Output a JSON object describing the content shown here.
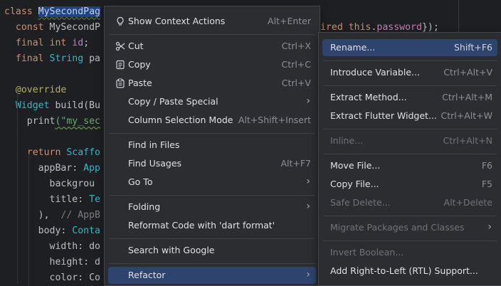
{
  "editor": {
    "lines": [
      {
        "segments": [
          {
            "t": "class ",
            "c": "kw"
          },
          {
            "t": "MySecondPag",
            "c": "sel"
          }
        ]
      },
      {
        "segments": [
          {
            "t": "  "
          },
          {
            "t": "const ",
            "c": "kw"
          },
          {
            "t": "MySecondP",
            "c": ""
          }
        ]
      },
      {
        "segments": [
          {
            "t": "  "
          },
          {
            "t": "final ",
            "c": "kw"
          },
          {
            "t": "int ",
            "c": "kw"
          },
          {
            "t": "id",
            "c": "ty"
          },
          {
            "t": ";"
          }
        ]
      },
      {
        "segments": [
          {
            "t": "  "
          },
          {
            "t": "final ",
            "c": "kw"
          },
          {
            "t": "String ",
            "c": "cl"
          },
          {
            "t": "pa",
            "c": ""
          }
        ]
      },
      {
        "segments": [
          {
            "t": ""
          }
        ]
      },
      {
        "segments": [
          {
            "t": "  "
          },
          {
            "t": "@override",
            "c": "an"
          }
        ]
      },
      {
        "segments": [
          {
            "t": "  "
          },
          {
            "t": "Widget ",
            "c": "cl"
          },
          {
            "t": "build",
            "c": ""
          },
          {
            "t": "(Bu"
          }
        ]
      },
      {
        "segments": [
          {
            "t": "    "
          },
          {
            "t": "print",
            "c": ""
          },
          {
            "t": "(\"my_sec",
            "c": "st wv"
          }
        ]
      },
      {
        "segments": [
          {
            "t": ""
          }
        ]
      },
      {
        "segments": [
          {
            "t": "    "
          },
          {
            "t": "return ",
            "c": "kw"
          },
          {
            "t": "Scaffo",
            "c": "cl"
          }
        ]
      },
      {
        "segments": [
          {
            "t": "      "
          },
          {
            "t": "appBar",
            "c": ""
          },
          {
            "t": ": "
          },
          {
            "t": "App",
            "c": "cl"
          }
        ]
      },
      {
        "segments": [
          {
            "t": "        "
          },
          {
            "t": "backgrou",
            "c": ""
          }
        ]
      },
      {
        "segments": [
          {
            "t": "        "
          },
          {
            "t": "title",
            "c": ""
          },
          {
            "t": ": "
          },
          {
            "t": "Te",
            "c": "cl"
          }
        ]
      },
      {
        "segments": [
          {
            "t": "      "
          },
          {
            "t": "),  "
          },
          {
            "t": "// AppB",
            "c": "cm"
          }
        ]
      },
      {
        "segments": [
          {
            "t": "      "
          },
          {
            "t": "body",
            "c": ""
          },
          {
            "t": ": "
          },
          {
            "t": "Conta",
            "c": "cl"
          }
        ]
      },
      {
        "segments": [
          {
            "t": "        "
          },
          {
            "t": "width",
            "c": ""
          },
          {
            "t": ": do"
          }
        ]
      },
      {
        "segments": [
          {
            "t": "        "
          },
          {
            "t": "height",
            "c": ""
          },
          {
            "t": ": d"
          }
        ]
      },
      {
        "segments": [
          {
            "t": "        "
          },
          {
            "t": "color",
            "c": ""
          },
          {
            "t": ": Co"
          }
        ]
      }
    ],
    "right_fragment": [
      {
        "t": "ired ",
        "c": "kw"
      },
      {
        "t": "this",
        "c": "kw"
      },
      {
        "t": "."
      },
      {
        "t": "password",
        "c": "ty"
      },
      {
        "t": "});"
      }
    ]
  },
  "context_menu": {
    "items": [
      {
        "label": "Show Context Actions",
        "shortcut": "Alt+Enter",
        "icon": "lightbulb-icon",
        "name": "show-context-actions"
      },
      {
        "sep": true
      },
      {
        "label": "Cut",
        "shortcut": "Ctrl+X",
        "icon": "scissors-icon",
        "name": "cut"
      },
      {
        "label": "Copy",
        "shortcut": "Ctrl+C",
        "icon": "copy-icon",
        "name": "copy"
      },
      {
        "label": "Paste",
        "shortcut": "Ctrl+V",
        "icon": "paste-icon",
        "name": "paste"
      },
      {
        "label": "Copy / Paste Special",
        "submenu": true,
        "name": "copy-paste-special"
      },
      {
        "label": "Column Selection Mode",
        "shortcut": "Alt+Shift+Insert",
        "name": "column-selection-mode"
      },
      {
        "sep": true
      },
      {
        "label": "Find in Files",
        "name": "find-in-files"
      },
      {
        "label": "Find Usages",
        "shortcut": "Alt+F7",
        "name": "find-usages"
      },
      {
        "label": "Go To",
        "submenu": true,
        "name": "go-to"
      },
      {
        "sep": true
      },
      {
        "label": "Folding",
        "submenu": true,
        "name": "folding"
      },
      {
        "label": "Reformat Code with 'dart format'",
        "name": "reformat-code"
      },
      {
        "sep": true
      },
      {
        "label": "Search with Google",
        "name": "search-with-google"
      },
      {
        "sep": true
      },
      {
        "label": "Refactor",
        "submenu": true,
        "active": true,
        "name": "refactor"
      }
    ]
  },
  "refactor_menu": {
    "items": [
      {
        "label": "Rename...",
        "shortcut": "Shift+F6",
        "active": true,
        "name": "rename"
      },
      {
        "sep": true
      },
      {
        "label": "Introduce Variable...",
        "shortcut": "Ctrl+Alt+V",
        "name": "introduce-variable"
      },
      {
        "sep": true
      },
      {
        "label": "Extract Method...",
        "shortcut": "Ctrl+Alt+M",
        "name": "extract-method"
      },
      {
        "label": "Extract Flutter Widget...",
        "shortcut": "Ctrl+Alt+W",
        "name": "extract-flutter-widget"
      },
      {
        "sep": true
      },
      {
        "label": "Inline...",
        "shortcut": "Ctrl+Alt+N",
        "disabled": true,
        "name": "inline"
      },
      {
        "sep": true
      },
      {
        "label": "Move File...",
        "shortcut": "F6",
        "name": "move-file"
      },
      {
        "label": "Copy File...",
        "shortcut": "F5",
        "name": "copy-file"
      },
      {
        "label": "Safe Delete...",
        "shortcut": "Alt+Delete",
        "disabled": true,
        "name": "safe-delete"
      },
      {
        "sep": true
      },
      {
        "label": "Migrate Packages and Classes",
        "submenu": true,
        "disabled": true,
        "name": "migrate-packages"
      },
      {
        "sep": true
      },
      {
        "label": "Invert Boolean...",
        "disabled": true,
        "name": "invert-boolean"
      },
      {
        "label": "Add Right-to-Left (RTL) Support...",
        "name": "add-rtl-support"
      }
    ]
  }
}
